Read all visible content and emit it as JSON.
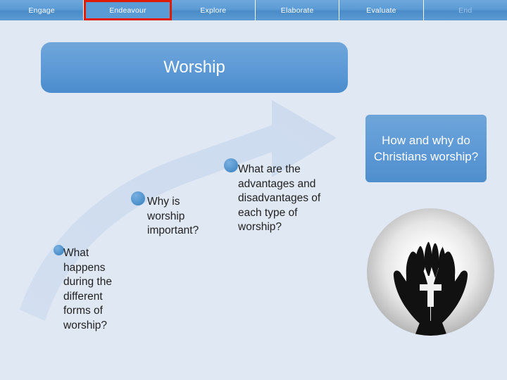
{
  "nav": {
    "tabs": [
      {
        "label": "Engage",
        "state": "normal"
      },
      {
        "label": "Endeavour",
        "state": "active"
      },
      {
        "label": "Explore",
        "state": "normal"
      },
      {
        "label": "Elaborate",
        "state": "normal"
      },
      {
        "label": "Evaluate",
        "state": "normal"
      },
      {
        "label": "End",
        "state": "dim"
      }
    ]
  },
  "slide": {
    "title": "Worship",
    "bullets": [
      {
        "text": "What happens during the different forms of worship?"
      },
      {
        "text": "Why is worship important?"
      },
      {
        "text": "What are the advantages and disadvantages of each type of worship?"
      }
    ],
    "question_box": "How and why do Christians worship?",
    "image_alt": "praying-hands-cross"
  },
  "colors": {
    "background": "#dfe8f3",
    "accent": "#5b9bd5",
    "active_outline": "#e01b00",
    "text": "#222222",
    "banner_text": "#ffffff"
  }
}
